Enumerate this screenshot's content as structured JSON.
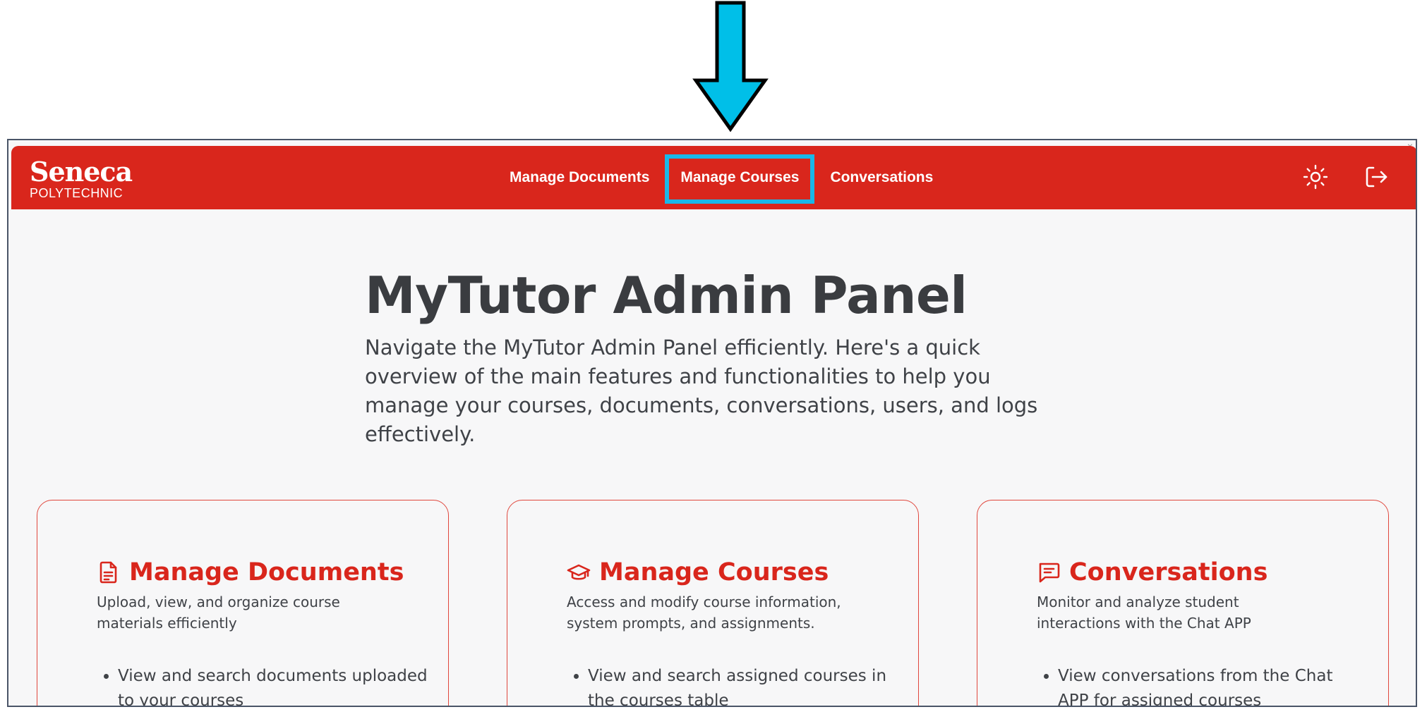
{
  "callout": {
    "icon": "arrow-down-icon",
    "color": "#00bfe8"
  },
  "header": {
    "logo_main": "Seneca",
    "logo_sub": "POLYTECHNIC",
    "nav": [
      {
        "label": "Manage Documents"
      },
      {
        "label": "Manage Courses"
      },
      {
        "label": "Conversations"
      }
    ],
    "icons": [
      "sun-theme-icon",
      "logout-icon"
    ],
    "brand_color": "#d9261c"
  },
  "hero": {
    "title": "MyTutor Admin Panel",
    "description": "Navigate the MyTutor Admin Panel efficiently. Here's a quick overview of the main features and functionalities to help you manage your courses, documents, conversations, users, and logs effectively."
  },
  "cards": [
    {
      "icon": "document-icon",
      "title": "Manage Documents",
      "description": "Upload, view, and organize course materials efficiently",
      "items": [
        "View and search documents uploaded to your courses"
      ]
    },
    {
      "icon": "graduation-cap-icon",
      "title": "Manage Courses",
      "description": "Access and modify course information, system prompts, and assignments.",
      "items": [
        "View and search assigned courses in the courses table"
      ]
    },
    {
      "icon": "chat-icon",
      "title": "Conversations",
      "description": "Monitor and analyze student interactions with the Chat APP",
      "items": [
        "View conversations from the Chat APP for assigned courses"
      ]
    }
  ]
}
